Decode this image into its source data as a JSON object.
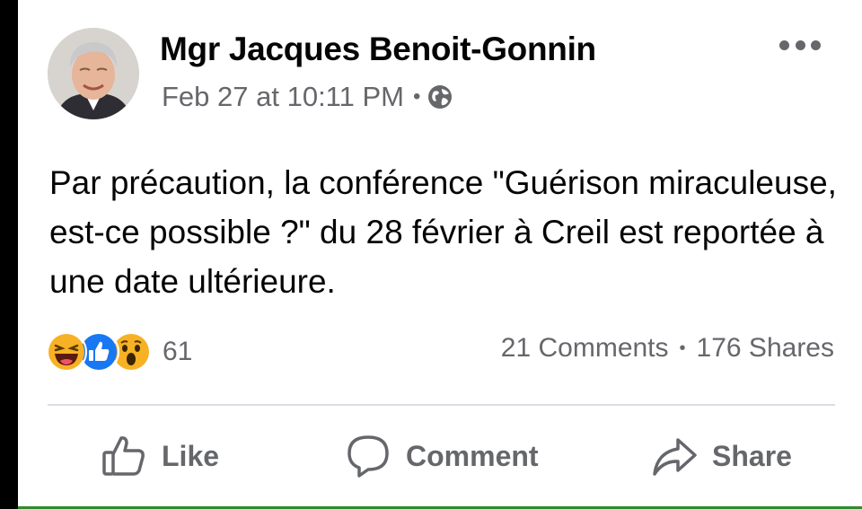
{
  "post": {
    "author": "Mgr Jacques Benoit-Gonnin",
    "timestamp": "Feb 27 at 10:11 PM",
    "separator": "•",
    "privacy_icon": "globe-icon",
    "menu_icon": "more-options-icon",
    "text": "Par précaution, la conférence \"Guérison miraculeuse, est-ce possible ?\" du 28 février à Creil est reportée à une date ultérieure."
  },
  "engagement": {
    "reaction_icons": [
      "haha-reaction-icon",
      "like-reaction-icon",
      "wow-reaction-icon"
    ],
    "reaction_count": "61",
    "comments": "21 Comments",
    "separator": "•",
    "shares": "176 Shares"
  },
  "actions": [
    {
      "label": "Like",
      "icon": "thumbs-up-icon"
    },
    {
      "label": "Comment",
      "icon": "comment-bubble-icon"
    },
    {
      "label": "Share",
      "icon": "share-arrow-icon"
    }
  ],
  "colors": {
    "like_blue": "#1877f2",
    "reaction_yellow": "#f7b125",
    "secondary_text": "#65676b"
  }
}
